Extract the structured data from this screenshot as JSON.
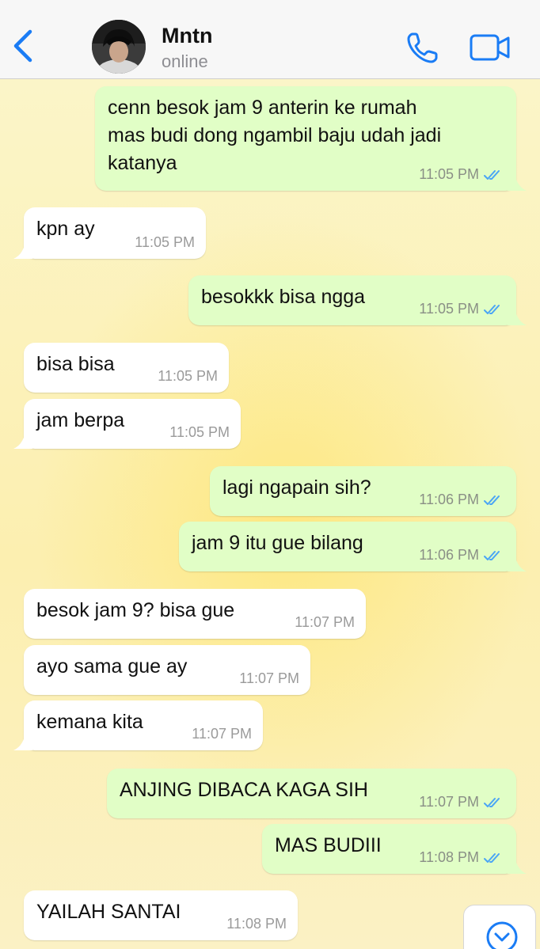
{
  "header": {
    "contact_name": "Mntn",
    "status": "online",
    "icons": {
      "back": "chevron-left-icon",
      "call": "phone-icon",
      "video": "video-camera-icon"
    }
  },
  "colors": {
    "outgoing": "#e1fec6",
    "incoming": "#ffffff",
    "accent": "#1a7cf5",
    "read_ticks": "#4aa5f5"
  },
  "messages": [
    {
      "direction": "out",
      "text": "cenn besok jam 9 anterin ke rumah\nmas budi dong ngambil baju udah jadi\nkatanya",
      "time": "11:05 PM",
      "read": true
    },
    {
      "direction": "in",
      "text": "kpn ay",
      "time": "11:05 PM"
    },
    {
      "direction": "out",
      "text": "besokkk bisa ngga",
      "time": "11:05 PM",
      "read": true
    },
    {
      "direction": "in",
      "text": "bisa bisa",
      "time": "11:05 PM"
    },
    {
      "direction": "in",
      "text": "jam berpa",
      "time": "11:05 PM"
    },
    {
      "direction": "out",
      "text": "lagi ngapain sih?",
      "time": "11:06 PM",
      "read": true
    },
    {
      "direction": "out",
      "text": "jam 9 itu gue bilang",
      "time": "11:06 PM",
      "read": true
    },
    {
      "direction": "in",
      "text": "besok jam 9? bisa gue",
      "time": "11:07 PM"
    },
    {
      "direction": "in",
      "text": "ayo sama gue ay",
      "time": "11:07 PM"
    },
    {
      "direction": "in",
      "text": "kemana kita",
      "time": "11:07 PM"
    },
    {
      "direction": "out",
      "text": "ANJING DIBACA KAGA SIH",
      "time": "11:07 PM",
      "read": true
    },
    {
      "direction": "out",
      "text": "MAS BUDIII",
      "time": "11:08 PM",
      "read": true
    },
    {
      "direction": "in",
      "text": "YAILAH SANTAI",
      "time": "11:08 PM"
    }
  ],
  "scroll_button": {
    "icon": "chevron-down-circle-icon"
  }
}
